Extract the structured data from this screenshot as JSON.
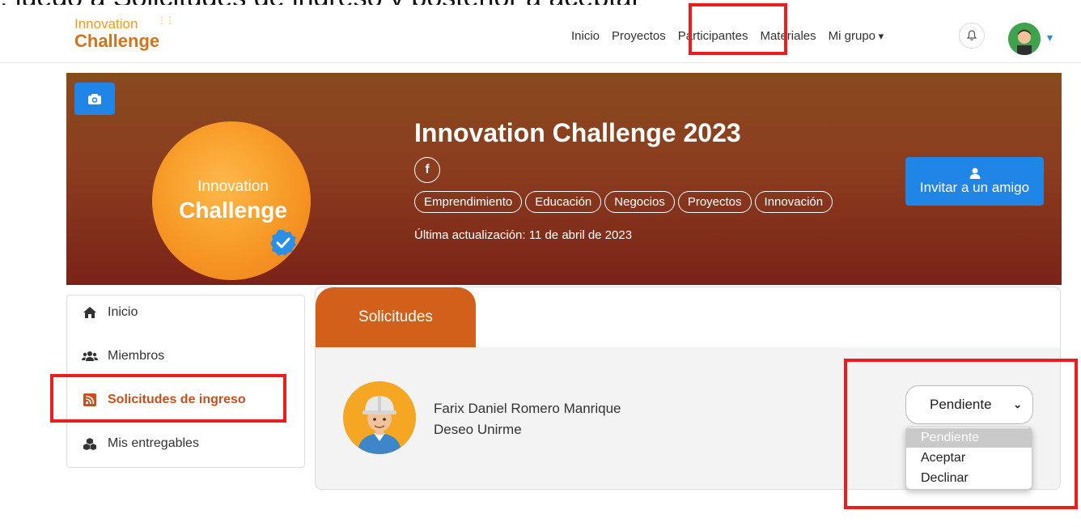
{
  "caption": {
    "text": ", luego a Solicitudes de ingreso y posterior a aceptar"
  },
  "navbar": {
    "logo_top": "Innovation",
    "logo_bottom": "Challenge",
    "links": [
      {
        "label": "Inicio"
      },
      {
        "label": "Proyectos"
      },
      {
        "label": "Participantes"
      },
      {
        "label": "Materiales"
      },
      {
        "label": "Mi grupo"
      }
    ]
  },
  "banner": {
    "logo_top": "Innovation",
    "logo_bottom": "Challenge",
    "title": "Innovation Challenge 2023",
    "facebook_glyph": "f",
    "tags": [
      "Emprendimiento",
      "Educación",
      "Negocios",
      "Proyectos",
      "Innovación"
    ],
    "last_update": "Última actualización: 11 de abril de 2023",
    "invite_label": "Invitar a un amigo"
  },
  "sidebar": {
    "items": [
      {
        "label": "Inicio",
        "icon": "home-icon"
      },
      {
        "label": "Miembros",
        "icon": "users-icon"
      },
      {
        "label": "Solicitudes de ingreso",
        "icon": "rss-icon"
      },
      {
        "label": "Mis entregables",
        "icon": "cubes-icon"
      }
    ]
  },
  "panel": {
    "tab_label": "Solicitudes",
    "request": {
      "name": "Farix Daniel Romero Manrique",
      "message": "Deseo Unirme"
    },
    "status": {
      "selected": "Pendiente",
      "options": [
        "Pendiente",
        "Aceptar",
        "Declinar"
      ]
    }
  },
  "colors": {
    "accent": "#d2601a",
    "primary_button": "#1f86e8",
    "highlight": "#ee1c1c",
    "active_sidebar": "#c8501c"
  }
}
